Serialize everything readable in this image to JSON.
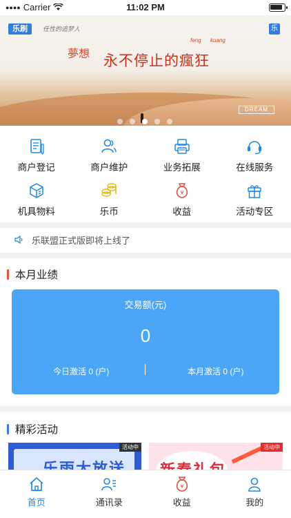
{
  "status_bar": {
    "carrier": "Carrier",
    "time": "11:02 PM"
  },
  "banner": {
    "brand_left": "乐刷",
    "signature": "任性的追梦人",
    "brand_right": "乐",
    "dream_word": "夢想",
    "slogan": "永不停止的瘋狂",
    "pinyin_1": "feng",
    "pinyin_2": "kuang",
    "tag": "DREAM",
    "dots_count": 5,
    "active_dot": 3
  },
  "menu": [
    {
      "label": "商户登记",
      "icon": "document-icon"
    },
    {
      "label": "商户维护",
      "icon": "users-icon"
    },
    {
      "label": "业务拓展",
      "icon": "printer-icon"
    },
    {
      "label": "在线服务",
      "icon": "headset-icon"
    },
    {
      "label": "机具物料",
      "icon": "cube-icon"
    },
    {
      "label": "乐币",
      "icon": "coins-icon"
    },
    {
      "label": "收益",
      "icon": "money-bag-icon"
    },
    {
      "label": "活动专区",
      "icon": "gift-icon"
    }
  ],
  "notice": {
    "text": "乐联盟正式版即将上线了",
    "icon": "speaker-icon"
  },
  "performance": {
    "title": "本月业绩",
    "label": "交易额(元)",
    "amount": "0",
    "today": "今日激活 0 (户)",
    "month": "本月激活 0 (户)"
  },
  "activities": {
    "title": "精彩活动",
    "items": [
      {
        "title": "乐雨大放送",
        "tag": "活动中"
      },
      {
        "title": "新春礼包",
        "tag": "活动中"
      }
    ]
  },
  "tabbar": [
    {
      "label": "首页",
      "icon": "home-icon",
      "active": true
    },
    {
      "label": "通讯录",
      "icon": "contacts-icon",
      "active": false
    },
    {
      "label": "收益",
      "icon": "money-bag-icon",
      "active": false
    },
    {
      "label": "我的",
      "icon": "person-icon",
      "active": false
    }
  ],
  "colors": {
    "accent": "#1e88e5",
    "card": "#4ba6f7",
    "section_bar_1": "#e05a3a",
    "section_bar_2": "#3a7be0",
    "icon_blue": "#1e88e5",
    "icon_red": "#e04a3a",
    "icon_gold": "#e8b91a"
  }
}
